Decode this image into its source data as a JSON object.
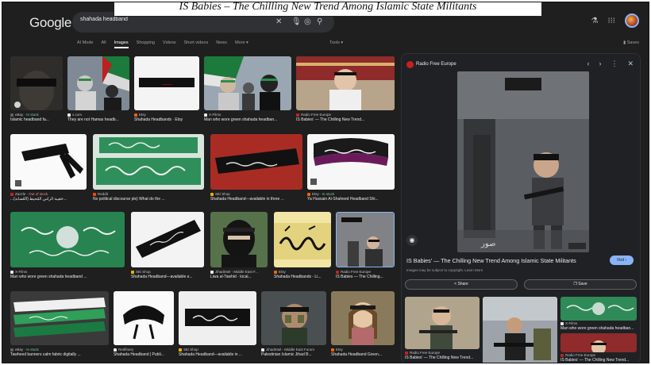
{
  "caption": "IS Babies – The Chilling New Trend Among Islamic State Militants",
  "header": {
    "logo": "Google",
    "search_value": "shahada headband",
    "clear_icon": "close-icon",
    "mic_icon": "mic-icon",
    "lens_icon": "camera-icon",
    "search_icon": "search-icon",
    "labs_icon": "flask-icon",
    "apps_icon": "grid-icon"
  },
  "tabs": [
    "AI Mode",
    "All",
    "Images",
    "Shopping",
    "Videos",
    "Short videos",
    "News",
    "More ▾"
  ],
  "active_tab": "Images",
  "tools_label": "Tools ▾",
  "saves_label": "Saves",
  "results": [
    {
      "source": "eBay",
      "status": "In stock",
      "title": "Islamic headband fa..."
    },
    {
      "source": "x.com",
      "status": "",
      "title": "They are not Hamas headb..."
    },
    {
      "source": "Etsy",
      "status": "",
      "title": "Shahada Headbands · Etsy"
    },
    {
      "source": "X-Films",
      "status": "",
      "title": "Man who wore green shahada headban..."
    },
    {
      "source": "Radio Free Europe",
      "status": "",
      "title": "IS Babies' — The Chilling New Trend..."
    },
    {
      "source": "Zazzle",
      "status": "Out of stock",
      "title": "...(العُصابة) حَقيبة الرأس المُحيط..."
    },
    {
      "source": "Reddit",
      "status": "",
      "title": "No political discourse pls) What do the ..."
    },
    {
      "source": "SEi Shop",
      "status": "",
      "title": "Shahada Headband—available in three ..."
    },
    {
      "source": "Etsy",
      "status": "In stock",
      "title": "Ya Hussain Al-Shaheed Headband Shi..."
    },
    {
      "source": "X-Films",
      "status": "",
      "title": "Man who wore green shahada headband ..."
    },
    {
      "source": "SEi Shop",
      "status": "",
      "title": "Shahada Headband—available e..."
    },
    {
      "source": "JihadIntel - Middle East F...",
      "status": "",
      "title": "Liwa al-Tawhid · local..."
    },
    {
      "source": "Etsy",
      "status": "",
      "title": "Shahada Headbands - Li..."
    },
    {
      "source": "Radio Free Europe",
      "status": "",
      "title": "IS Babies — The Chilling..."
    },
    {
      "source": "eBay",
      "status": "In stock",
      "title": "Tawheed banners calm fabric digitally ..."
    },
    {
      "source": "Redfinery",
      "status": "",
      "title": "Shahada Headband | Publi..."
    },
    {
      "source": "SEi Shop",
      "status": "",
      "title": "Shahada Headband—available in ..."
    },
    {
      "source": "JihadIntel - Middle East Forum",
      "status": "",
      "title": "Palestinian Islamic Jihad B..."
    },
    {
      "source": "Etsy",
      "status": "",
      "title": "Shahada Headband Green..."
    }
  ],
  "panel": {
    "source": "Radio Free Europe",
    "prev_icon": "chevron-left-icon",
    "next_icon": "chevron-right-icon",
    "more_icon": "more-vert-icon",
    "close_icon": "close-icon",
    "title": "IS Babies'  — The Chilling New Trend Among Islamic State Militants",
    "visit_label": "Visit ›",
    "note": "Images may be subject to copyright. Learn More",
    "share_label": "< Share",
    "save_label": "❐ Save",
    "related": [
      {
        "source": "Radio Free Europe",
        "title": "IS Babies' — The Chilling New Trend..."
      },
      {
        "source": "",
        "title": ""
      },
      {
        "source": "X-Films",
        "title": "Man who wore green shahada headban..."
      },
      {
        "source": "Radio Free Europe",
        "title": "IS Babies' — The Chilling New Trend..."
      }
    ]
  },
  "colors": {
    "background": "#1f1f1f",
    "panel": "#202124",
    "accent": "#8ab4f8",
    "headband_green": "#2f8f5b",
    "headband_black": "#111111"
  }
}
